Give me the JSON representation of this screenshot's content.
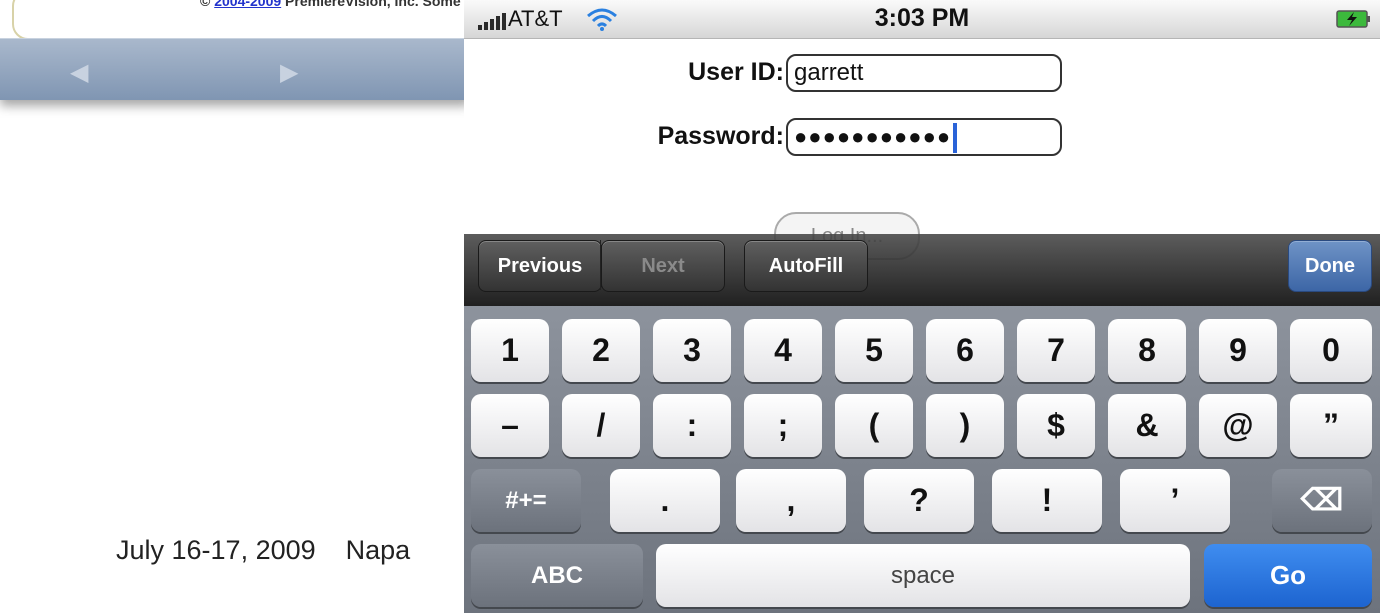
{
  "background": {
    "copyright_prefix": "© ",
    "copyright_link": "2004-2009",
    "copyright_suffix": " PremiereVision, Inc. Some rights reserved.",
    "nav_back": "◀",
    "nav_forward": "▶",
    "footer": "July 16-17, 2009    Napa"
  },
  "status_bar": {
    "carrier": "AT&T",
    "time": "3:03 PM",
    "signal_icon": "signal-bars-icon",
    "wifi_icon": "wifi-icon",
    "battery_icon": "battery-charging-icon"
  },
  "form": {
    "user_id_label": "User ID:",
    "user_id_value": "garrett",
    "password_label": "Password:",
    "password_value": "●●●●●●●●●●●",
    "login_button": "Log In..."
  },
  "assistant": {
    "previous": "Previous",
    "next": "Next",
    "autofill": "AutoFill",
    "done": "Done"
  },
  "keyboard": {
    "row1": [
      "1",
      "2",
      "3",
      "4",
      "5",
      "6",
      "7",
      "8",
      "9",
      "0"
    ],
    "row2": [
      "–",
      "/",
      ":",
      ";",
      "(",
      ")",
      "$",
      "&",
      "@",
      "”"
    ],
    "row3": [
      ".",
      ",",
      "?",
      "!",
      "’"
    ],
    "symbols_key": "#+=",
    "delete_key": "⌫",
    "abc_key": "ABC",
    "space_key": "space",
    "go_key": "Go"
  },
  "colors": {
    "caret": "#2a63d8",
    "done_button": "#3d66a6",
    "go_button": "#1d64d0"
  }
}
